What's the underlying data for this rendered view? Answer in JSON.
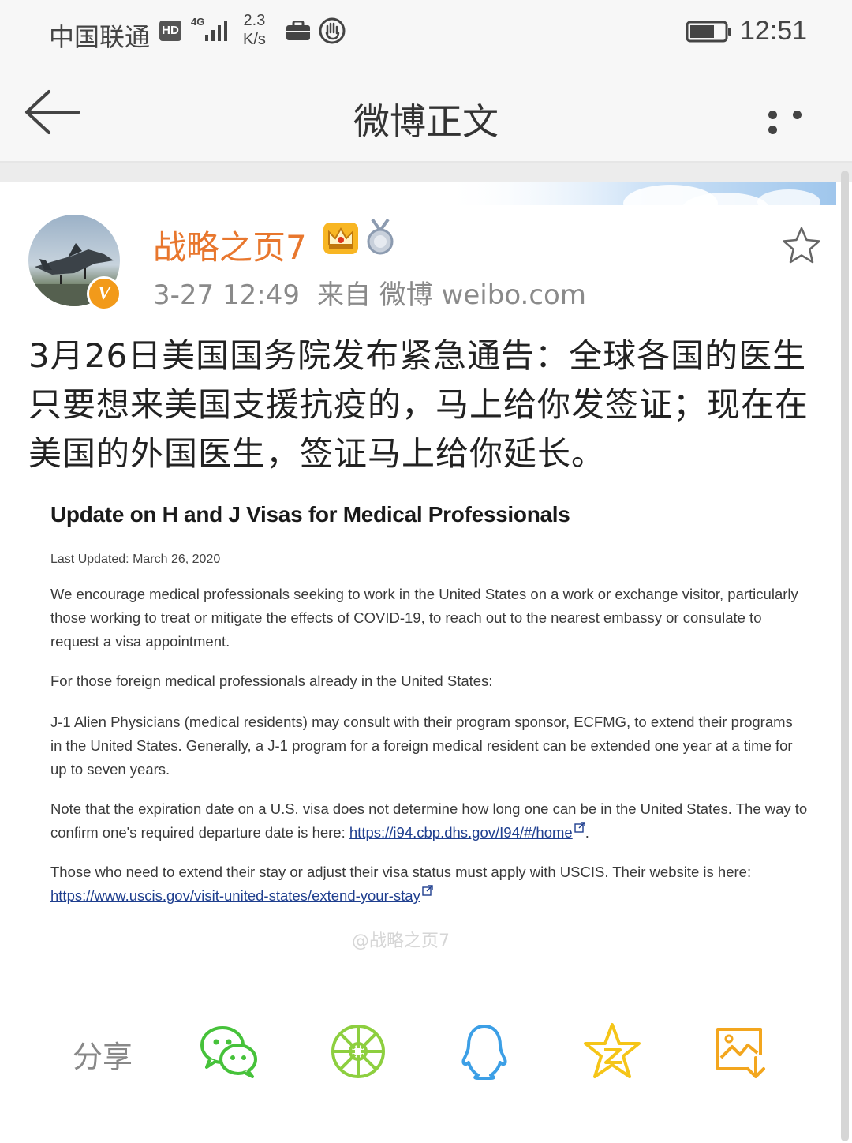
{
  "status_bar": {
    "carrier": "中国联通",
    "hd": "HD",
    "network": "4G",
    "speed_value": "2.3",
    "speed_unit": "K/s",
    "time": "12:51"
  },
  "nav": {
    "title": "微博正文"
  },
  "post": {
    "username": "战略之页7",
    "verified": "V",
    "timestamp": "3-27 12:49",
    "source": "来自 微博 weibo.com",
    "text": "3月26日美国国务院发布紧急通告：全球各国的医生只要想来美国支援抗疫的，马上给你发签证；现在在美国的外国医生，签证马上给你延长。"
  },
  "embed": {
    "title": "Update on H and J Visas for Medical Professionals",
    "last_updated": "Last Updated: March 26, 2020",
    "p1": "We encourage medical professionals seeking to work in the United States on a work or exchange visitor, particularly those working to treat or mitigate the effects of COVID-19, to reach out to the nearest embassy or consulate to request a visa appointment.",
    "p2": "For those foreign medical professionals already in the United States:",
    "p3": "J-1 Alien Physicians (medical residents) may consult with their program sponsor, ECFMG, to extend their programs in the United States.  Generally, a J-1 program for a foreign medical resident can be extended one year at a time for up to seven years.",
    "p4_text": "Note that the expiration date on a U.S. visa does not determine how long one can be in the United States.  The way to confirm one's required departure date is here: ",
    "p4_link": "https://i94.cbp.dhs.gov/I94/#/home",
    "p4_end": ".",
    "p5_text": "Those who need to extend their stay or adjust their visa status must apply with USCIS.  Their website is here: ",
    "p5_link": "https://www.uscis.gov/visit-united-states/extend-your-stay",
    "watermark": "@战略之页7"
  },
  "share": {
    "label": "分享",
    "icons": [
      "wechat-icon",
      "moments-icon",
      "qq-icon",
      "qzone-icon",
      "save-image-icon"
    ]
  },
  "colors": {
    "username": "#e8772e",
    "verified": "#f29a1a",
    "wechat": "#46c23a",
    "moments": "#8dcf3f",
    "qq": "#3c9fe6",
    "qzone": "#f5c518",
    "save": "#f3a61e"
  }
}
